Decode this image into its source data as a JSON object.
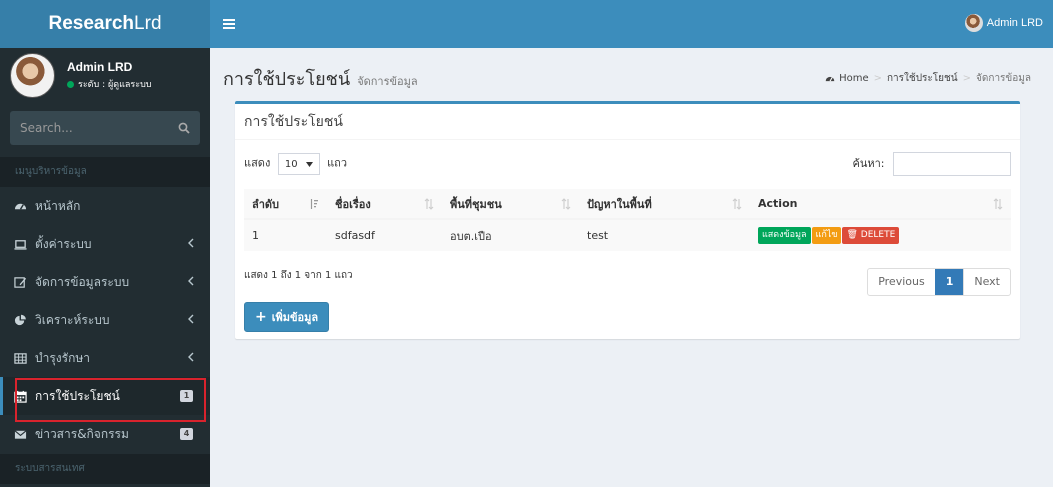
{
  "sidebar": {
    "logo_bold": "Research",
    "logo_light": "Lrd",
    "user_name": "Admin LRD",
    "user_status": "ระดับ : ผู้ดูแลระบบ",
    "search_placeholder": "Search...",
    "menu_header": "เมนูบริหารข้อมูล",
    "menu_footer_header": "ระบบสารสนเทศ",
    "items": [
      {
        "label": "หน้าหลัก",
        "icon": "dashboard-icon"
      },
      {
        "label": "ตั้งค่าระบบ",
        "icon": "laptop-icon"
      },
      {
        "label": "จัดการข้อมูลระบบ",
        "icon": "edit-icon"
      },
      {
        "label": "วิเคราะห์ระบบ",
        "icon": "pie-chart-icon"
      },
      {
        "label": "บำรุงรักษา",
        "icon": "table-icon"
      },
      {
        "label": "การใช้ประโยชน์",
        "icon": "calendar-icon",
        "count": "1"
      },
      {
        "label": "ข่าวสาร&กิจกรรม",
        "icon": "envelope-icon",
        "count": "4"
      }
    ]
  },
  "topbar": {
    "user_label": "Admin LRD"
  },
  "page": {
    "title": "การใช้ประโยชน์",
    "subtitle": "จัดการข้อมูล",
    "breadcrumb": [
      "Home",
      "การใช้ประโยชน์",
      "จัดการข้อมูล"
    ]
  },
  "box": {
    "title": "การใช้ประโยชน์",
    "show_label": "แสดง",
    "length_value": "10",
    "rows_label": "แถว",
    "search_label": "ค้นหา:",
    "columns": [
      "ลำดับ",
      "ชื่อเรื่อง",
      "พื้นที่ชุมชน",
      "ปัญหาในพื้นที่",
      "Action"
    ],
    "rows": [
      {
        "no": "1",
        "title": "sdfasdf",
        "area": "อบต.เปือ",
        "problem": "test"
      }
    ],
    "action_view": "แสดงข้อมูล",
    "action_edit": "แก้ไข",
    "action_delete": "DELETE",
    "info": "แสดง 1 ถึง 1 จาก 1 แถว",
    "pager": {
      "prev": "Previous",
      "current": "1",
      "next": "Next"
    },
    "add_button": "เพิ่มข้อมูล"
  },
  "colors": {
    "topbar": "#3c8dbc",
    "logo_bg": "#367fa9",
    "sidebar": "#222d32",
    "highlight": "#d9232d"
  }
}
